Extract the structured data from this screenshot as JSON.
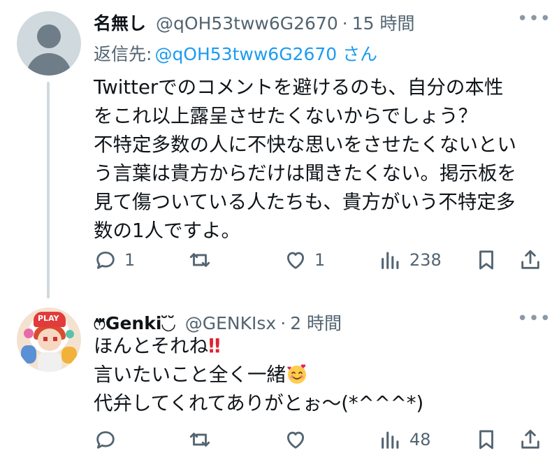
{
  "tweet1": {
    "author_name": "名無し",
    "handle": "@qOH53tww6G2670",
    "separator": "·",
    "time": "15 時間",
    "reply_prefix": "返信先:",
    "reply_handle": "@qOH53tww6G2670 さん",
    "lines": [
      "Twitterでのコメントを避けるのも、自分の本性",
      "をこれ以上露呈させたくないからでしょう？",
      "不特定多数の人に不快な思いをさせたくないとい",
      "う言葉は貴方からだけは聞きたくない。掲示板を",
      "見て傷ついている人たちも、貴方がいう不特定多",
      "数の1人ですよ。"
    ],
    "reply_count": "1",
    "retweet_count": "",
    "like_count": "1",
    "view_count": "238",
    "more_label": "•••"
  },
  "tweet2": {
    "author_name": "ෆ⃛Genki◟̆◞̆",
    "handle": "@GENKIsx",
    "separator": "·",
    "time": "2 時間",
    "line1": "ほんとそれね",
    "line1_emoji": "‼",
    "line2": "言いたいこと全く一緒",
    "line3": "代弁してくれてありがとぉ〜(*^^^*)",
    "reply_count": "",
    "retweet_count": "",
    "like_count": "",
    "view_count": "48",
    "more_label": "•••",
    "avatar_badge": "PLAY"
  },
  "icons": {
    "reply": "reply-icon",
    "retweet": "retweet-icon",
    "like": "heart-icon",
    "views": "views-icon",
    "bookmark": "bookmark-icon",
    "share": "share-icon",
    "more": "more-icon"
  },
  "colors": {
    "link": "#1d9bf0",
    "secondary_text": "#536471",
    "primary_text": "#0f1419",
    "thread_line": "#cfd9de"
  }
}
